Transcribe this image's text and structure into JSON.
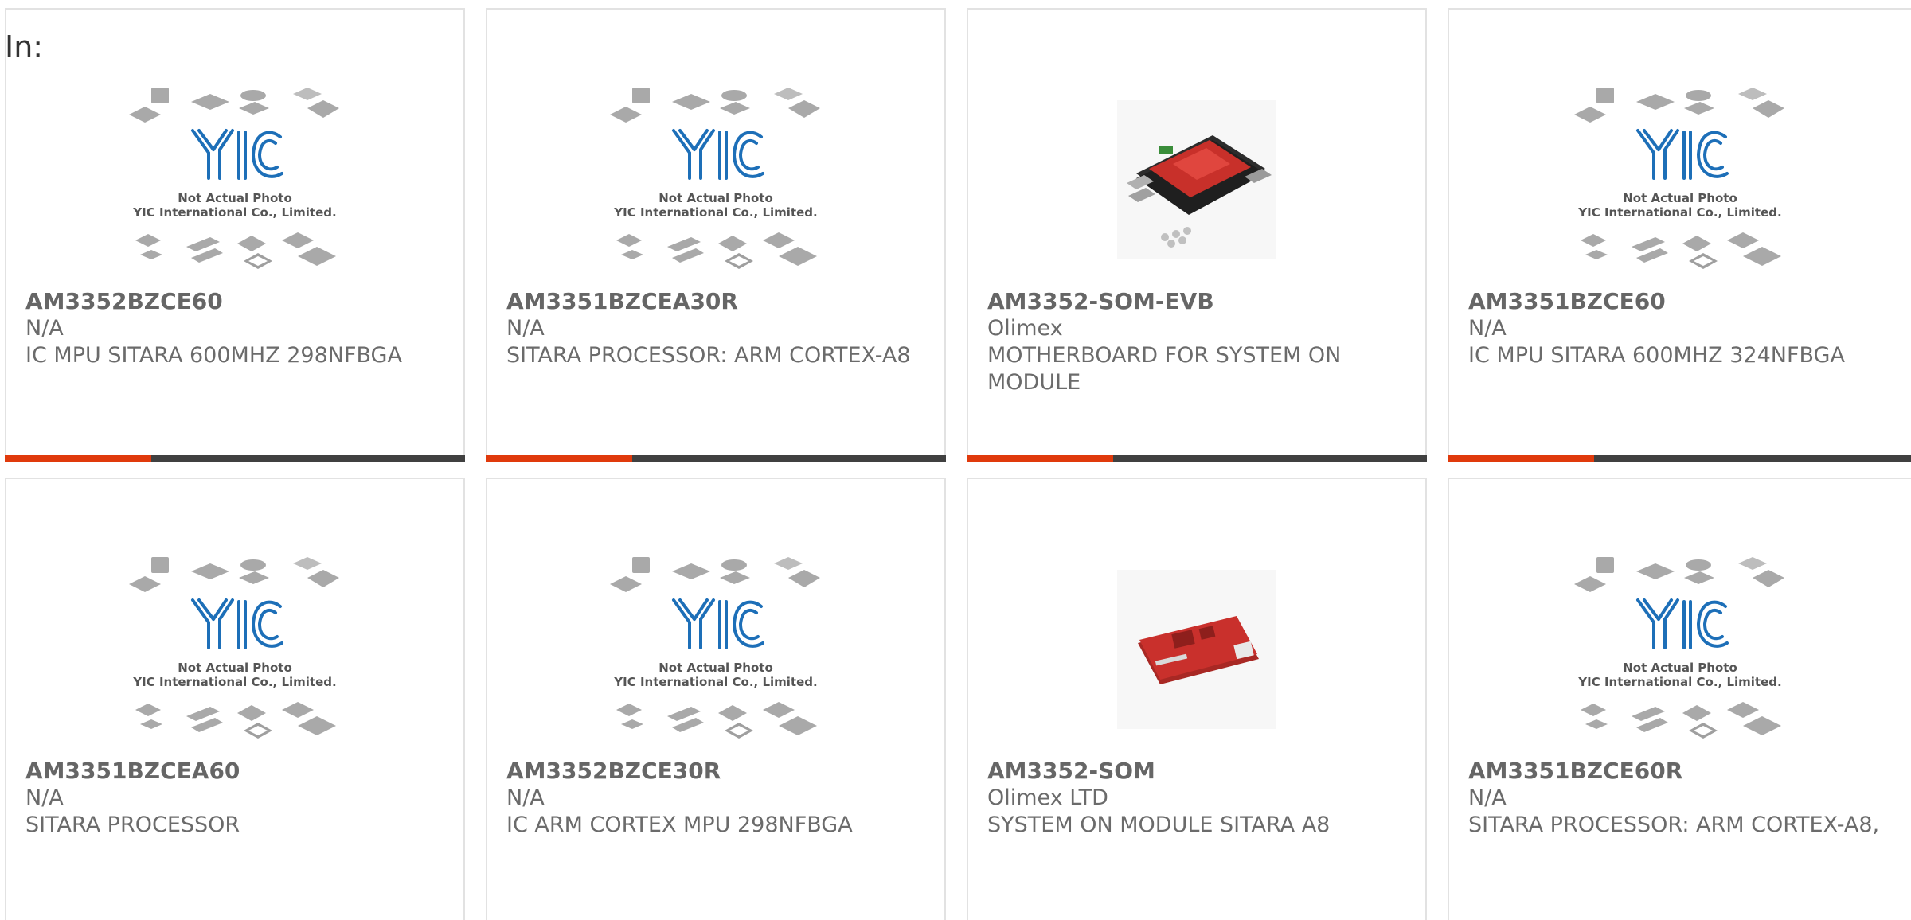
{
  "filter": {
    "label": "In:"
  },
  "placeholder_image": {
    "line1": "Not Actual Photo",
    "line2": "YIC International Co., Limited."
  },
  "products": [
    {
      "part_number": "AM3352BZCE60",
      "manufacturer": "N/A",
      "description": "IC MPU SITARA 600MHZ 298NFBGA",
      "image": "placeholder"
    },
    {
      "part_number": "AM3351BZCEA30R",
      "manufacturer": "N/A",
      "description": "SITARA PROCESSOR: ARM CORTEX-A8",
      "image": "placeholder"
    },
    {
      "part_number": "AM3352-SOM-EVB",
      "manufacturer": "Olimex",
      "description": "MOTHERBOARD FOR SYSTEM ON MODULE",
      "image": "board-evb-photo"
    },
    {
      "part_number": "AM3351BZCE60",
      "manufacturer": "N/A",
      "description": "IC MPU SITARA 600MHZ 324NFBGA",
      "image": "placeholder"
    },
    {
      "part_number": "AM3351BZCEA60",
      "manufacturer": "N/A",
      "description": "SITARA PROCESSOR",
      "image": "placeholder"
    },
    {
      "part_number": "AM3352BZCE30R",
      "manufacturer": "N/A",
      "description": "IC ARM CORTEX MPU 298NFBGA",
      "image": "placeholder"
    },
    {
      "part_number": "AM3352-SOM",
      "manufacturer": "Olimex LTD",
      "description": "SYSTEM ON MODULE SITARA A8",
      "image": "board-som-photo"
    },
    {
      "part_number": "AM3351BZCE60R",
      "manufacturer": "N/A",
      "description": "SITARA PROCESSOR: ARM CORTEX-A8,",
      "image": "placeholder"
    }
  ],
  "colors": {
    "accent": "#e03a0c",
    "bar": "#404040",
    "logo_blue": "#1d6fb8",
    "text": "#6b6b6b"
  }
}
